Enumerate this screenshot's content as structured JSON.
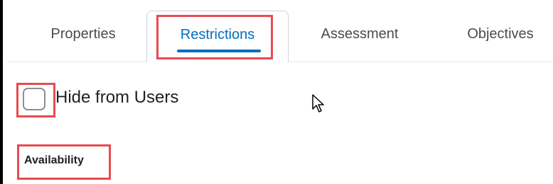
{
  "tabs": [
    {
      "label": "Properties",
      "active": false
    },
    {
      "label": "Restrictions",
      "active": true
    },
    {
      "label": "Assessment",
      "active": false
    },
    {
      "label": "Objectives",
      "active": false
    }
  ],
  "visibility": {
    "hide_label": "Hide from Users",
    "checked": false
  },
  "availability": {
    "heading": "Availability"
  },
  "colors": {
    "accent": "#006fbf",
    "highlight": "#e84a4f",
    "text": "#494c4e"
  },
  "icons": {
    "pointer": "mouse-pointer-icon"
  }
}
